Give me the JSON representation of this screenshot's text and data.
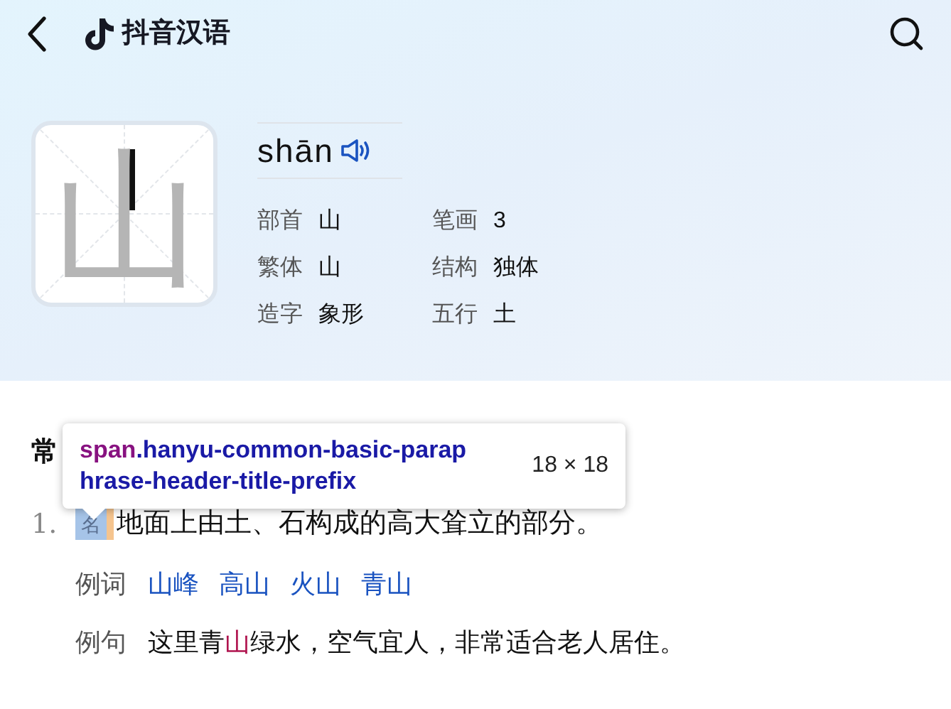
{
  "header": {
    "title": "抖音汉语"
  },
  "character": {
    "glyph": "山",
    "pinyin": "shān",
    "info": [
      {
        "label": "部首",
        "value": "山"
      },
      {
        "label": "笔画",
        "value": "3"
      },
      {
        "label": "繁体",
        "value": "山"
      },
      {
        "label": "结构",
        "value": "独体"
      },
      {
        "label": "造字",
        "value": "象形"
      },
      {
        "label": "五行",
        "value": "土"
      }
    ]
  },
  "section": {
    "title_visible": "常"
  },
  "inspector_tooltip": {
    "tag": "span",
    "class_name": ".hanyu-common-basic-paraphrase-header-title-prefix",
    "size": "18 × 18"
  },
  "definitions": [
    {
      "number": "1.",
      "part_of_speech": "名",
      "text": "地面上由土、石构成的高大耸立的部分。",
      "example_words_label": "例词",
      "example_words": [
        "山峰",
        "高山",
        "火山",
        "青山"
      ],
      "example_sentence_label": "例句",
      "example_sentence": [
        {
          "text": "这里青",
          "highlight": false
        },
        {
          "text": "山",
          "highlight": true
        },
        {
          "text": "绿水，空气宜人，非常适合老人居住。",
          "highlight": false
        }
      ]
    }
  ]
}
